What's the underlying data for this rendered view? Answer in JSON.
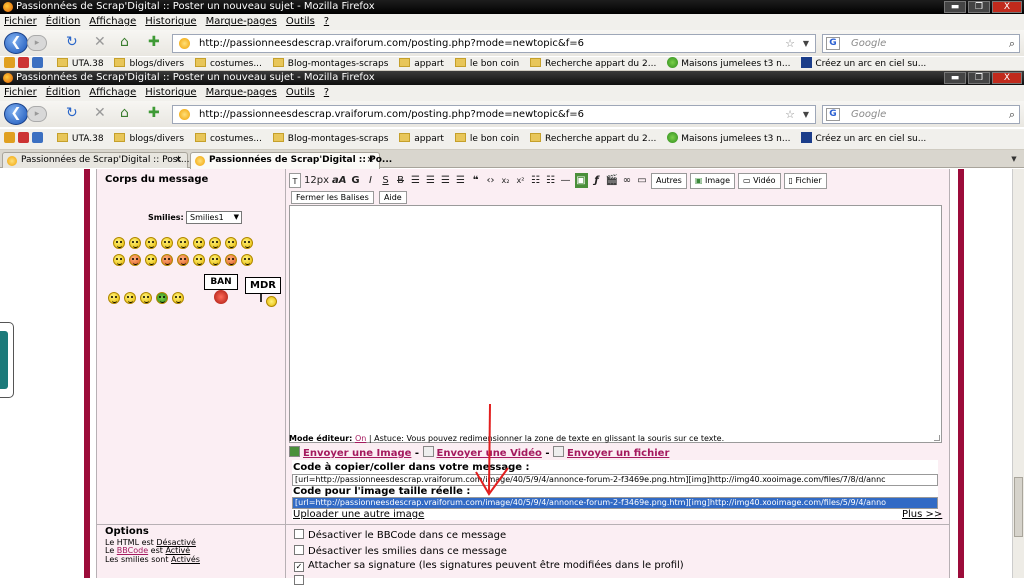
{
  "window_outer": {
    "title": "Passionnées de Scrap'Digital :: Poster un nouveau sujet - Mozilla Firefox"
  },
  "window_inner": {
    "title": "Passionnées de Scrap'Digital :: Poster un nouveau sujet - Mozilla Firefox"
  },
  "window_buttons": {
    "minimize": "▬",
    "maximize": "❐",
    "close": "X"
  },
  "menu": [
    "Fichier",
    "Édition",
    "Affichage",
    "Historique",
    "Marque-pages",
    "Outils",
    "?"
  ],
  "address": {
    "url": "http://passionneesdescrap.vraiforum.com/posting.php?mode=newtopic&f=6"
  },
  "search": {
    "placeholder": "Google",
    "engine_letter": "G"
  },
  "bookmarks": [
    {
      "label": "UTA.38",
      "type": "folder"
    },
    {
      "label": "blogs/divers",
      "type": "folder"
    },
    {
      "label": "costumes...",
      "type": "folder"
    },
    {
      "label": "Blog-montages-scraps",
      "type": "folder"
    },
    {
      "label": "appart",
      "type": "folder"
    },
    {
      "label": "le bon coin",
      "type": "folder"
    },
    {
      "label": "Recherche appart du 2...",
      "type": "folder"
    },
    {
      "label": "Maisons jumelees t3 n...",
      "type": "page"
    },
    {
      "label": "Créez un arc en ciel su...",
      "type": "page"
    }
  ],
  "tabs": [
    {
      "label": "Passionnées de Scrap'Digital :: Post...",
      "active": false
    },
    {
      "label": "Passionnées de Scrap'Digital :: Po...",
      "active": true
    }
  ],
  "form": {
    "body_label": "Corps du message",
    "smilies_label": "Smilies:",
    "smilies_select": "Smilies1",
    "sign_ban": "BAN",
    "sign_mdr": "MDR",
    "toolbar": {
      "size": "12px",
      "buttons": [
        "G",
        "I",
        "S",
        "B"
      ],
      "autres": "Autres",
      "image": "Image",
      "video": "Vidéo",
      "fichier": "Fichier",
      "fermer": "Fermer les Balises",
      "aide": "Aide"
    },
    "mode_label": "Mode éditeur:",
    "mode_value": "On",
    "mode_tip": "| Astuce: Vous pouvez redimensionner la zone de texte en glissant la souris sur ce texte.",
    "send_image": "Envoyer une Image",
    "send_video": "Envoyer une Vidéo",
    "send_file": "Envoyer un fichier",
    "code_copy_label": "Code à copier/coller dans votre message :",
    "code_copy_value": "[url=http://passionneesdescrap.vraiforum.com/image/40/5/9/4/annonce-forum-2-f3469e.png.htm][img]http://img40.xooimage.com/files/7/8/d/annc",
    "code_real_label": "Code pour l'image taille réelle :",
    "code_real_value": "[url=http://passionneesdescrap.vraiforum.com/image/40/5/9/4/annonce-forum-2-f3469e.png.htm][img]http://img40.xooimage.com/files/5/9/4/anno",
    "upload_other": "Uploader une autre image",
    "plus": "Plus >>"
  },
  "options": {
    "title": "Options",
    "html_prefix": "Le HTML est",
    "html_state": "Désactivé",
    "bbcode_prefix": "Le",
    "bbcode_link": "BBCode",
    "bbcode_mid": "est",
    "bbcode_state": "Activé",
    "smilies_prefix": "Les smilies sont",
    "smilies_state": "Activés"
  },
  "checkboxes": [
    {
      "label": "Désactiver le BBCode dans ce message",
      "checked": false
    },
    {
      "label": "Désactiver les smilies dans ce message",
      "checked": false
    },
    {
      "label": "Attacher sa signature (les signatures peuvent être modifiées dans le profil)",
      "checked": true
    }
  ],
  "colors": {
    "frame": "#9c0c3a",
    "panel": "#fbeef3",
    "link": "#a4195e",
    "arrow": "#e21f1f",
    "selection": "#316ac5"
  }
}
